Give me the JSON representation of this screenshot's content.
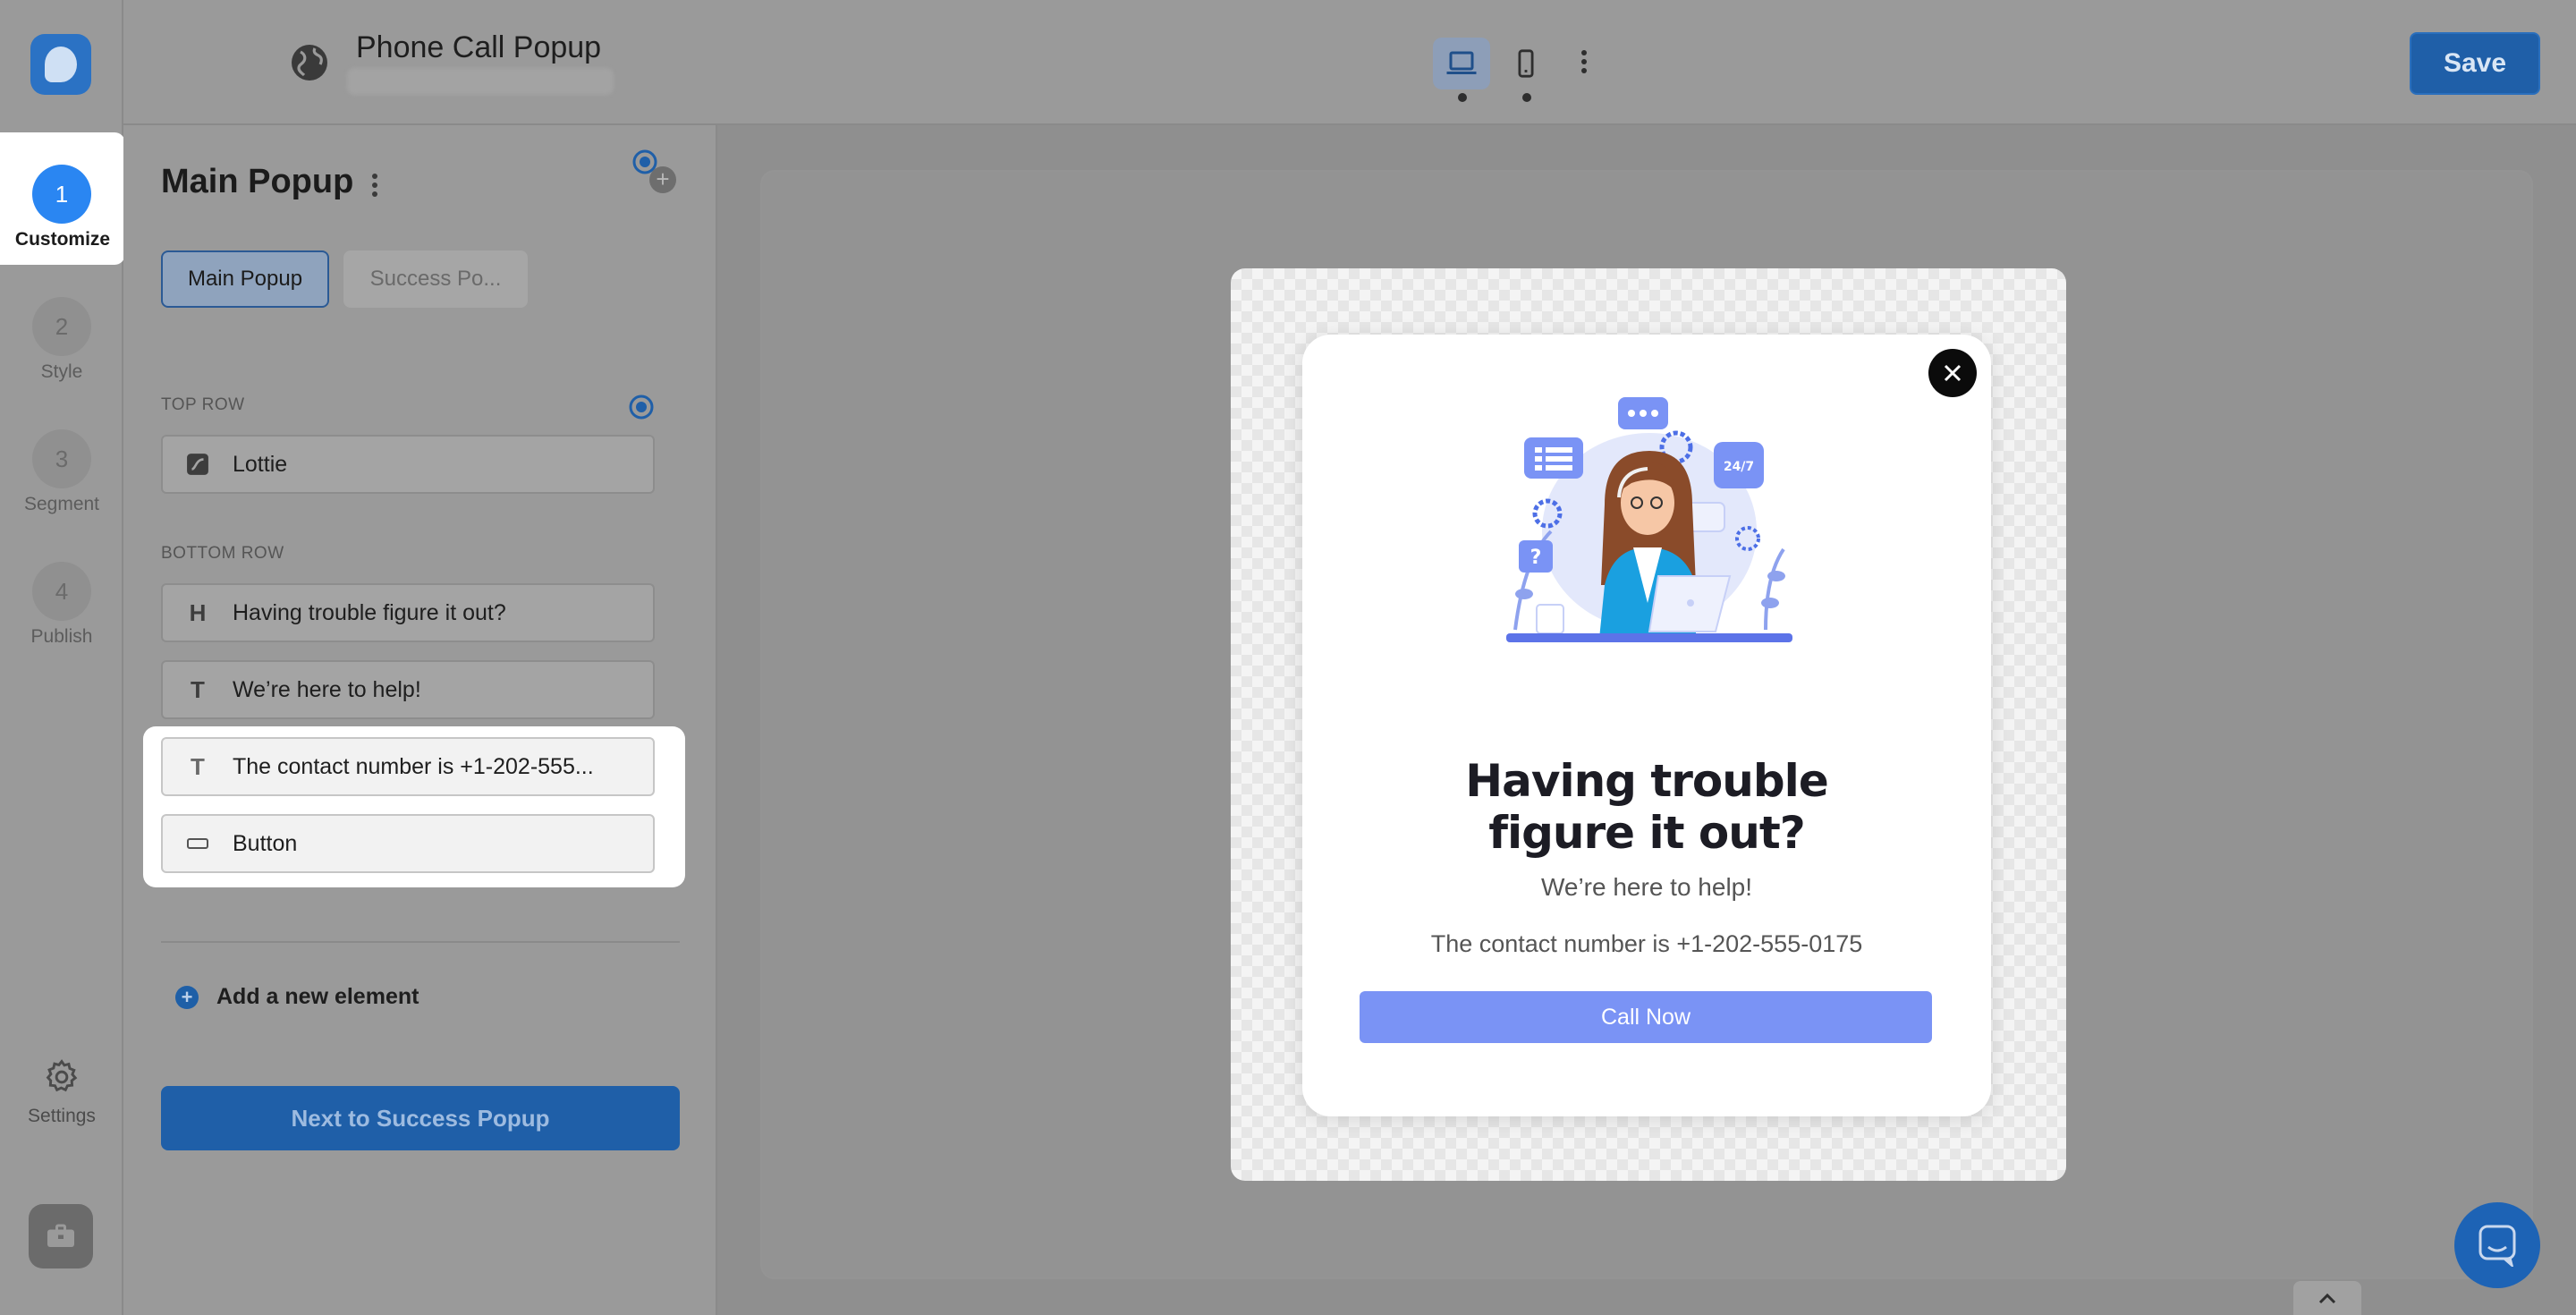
{
  "header": {
    "title": "Phone Call Popup",
    "save_label": "Save"
  },
  "rail": {
    "steps": [
      {
        "num": "1",
        "label": "Customize"
      },
      {
        "num": "2",
        "label": "Style"
      },
      {
        "num": "3",
        "label": "Segment"
      },
      {
        "num": "4",
        "label": "Publish"
      }
    ],
    "settings_label": "Settings"
  },
  "panel": {
    "title": "Main Popup",
    "tabs": [
      {
        "label": "Main Popup"
      },
      {
        "label": "Success Po..."
      }
    ],
    "top_row_label": "TOP ROW",
    "top_row_items": [
      {
        "icon": "lottie-icon",
        "label": "Lottie"
      }
    ],
    "bottom_row_label": "BOTTOM ROW",
    "bottom_row_items": [
      {
        "icon": "heading-icon",
        "glyph": "H",
        "label": "Having trouble figure it out?"
      },
      {
        "icon": "text-icon",
        "glyph": "T",
        "label": "We’re here to help!"
      },
      {
        "icon": "text-icon",
        "glyph": "T",
        "label": "The contact number is +1-202-555..."
      },
      {
        "icon": "button-icon",
        "label": "Button"
      }
    ],
    "add_element_label": "Add a new element",
    "next_button_label": "Next to Success Popup"
  },
  "popup": {
    "heading_line1": "Having trouble",
    "heading_line2": "figure it out?",
    "subtext": "We’re here to help!",
    "contact": "The contact number is +1-202-555-0175",
    "button_label": "Call Now",
    "illustration_text": "24/7"
  },
  "colors": {
    "primary": "#1f5fa8",
    "active_step": "#2a86f2",
    "call_button": "#7a93f5",
    "overlay": "#8f8f8f"
  }
}
